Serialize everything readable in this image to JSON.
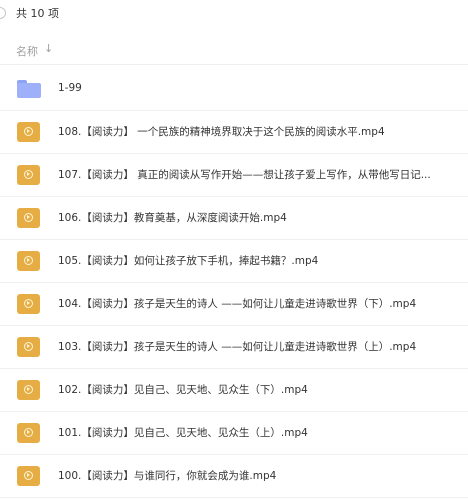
{
  "header": {
    "total": "共 10 项",
    "column_name": "名称",
    "sort_indicator": "↓"
  },
  "items": [
    {
      "name": "1-99",
      "type": "folder-icon"
    },
    {
      "name": "108.【阅读力】 一个民族的精神境界取决于这个民族的阅读水平.mp4",
      "type": "video-file-icon"
    },
    {
      "name": "107.【阅读力】 真正的阅读从写作开始——想让孩子爱上写作，从带他写日记...",
      "type": "video-file-icon"
    },
    {
      "name": "106.【阅读力】教育奠基，从深度阅读开始.mp4",
      "type": "video-file-icon"
    },
    {
      "name": "105.【阅读力】如何让孩子放下手机，捧起书籍？.mp4",
      "type": "video-file-icon"
    },
    {
      "name": "104.【阅读力】孩子是天生的诗人 ——如何让儿童走进诗歌世界（下）.mp4",
      "type": "video-file-icon"
    },
    {
      "name": "103.【阅读力】孩子是天生的诗人 ——如何让儿童走进诗歌世界（上）.mp4",
      "type": "video-file-icon"
    },
    {
      "name": "102.【阅读力】见自己、见天地、见众生（下）.mp4",
      "type": "video-file-icon"
    },
    {
      "name": "101.【阅读力】见自己、见天地、见众生（上）.mp4",
      "type": "video-file-icon"
    },
    {
      "name": "100.【阅读力】与谁同行，你就会成为谁.mp4",
      "type": "video-file-icon"
    }
  ],
  "colors": {
    "folder": "#9fb0fa",
    "video_file": "#e5ad43"
  }
}
